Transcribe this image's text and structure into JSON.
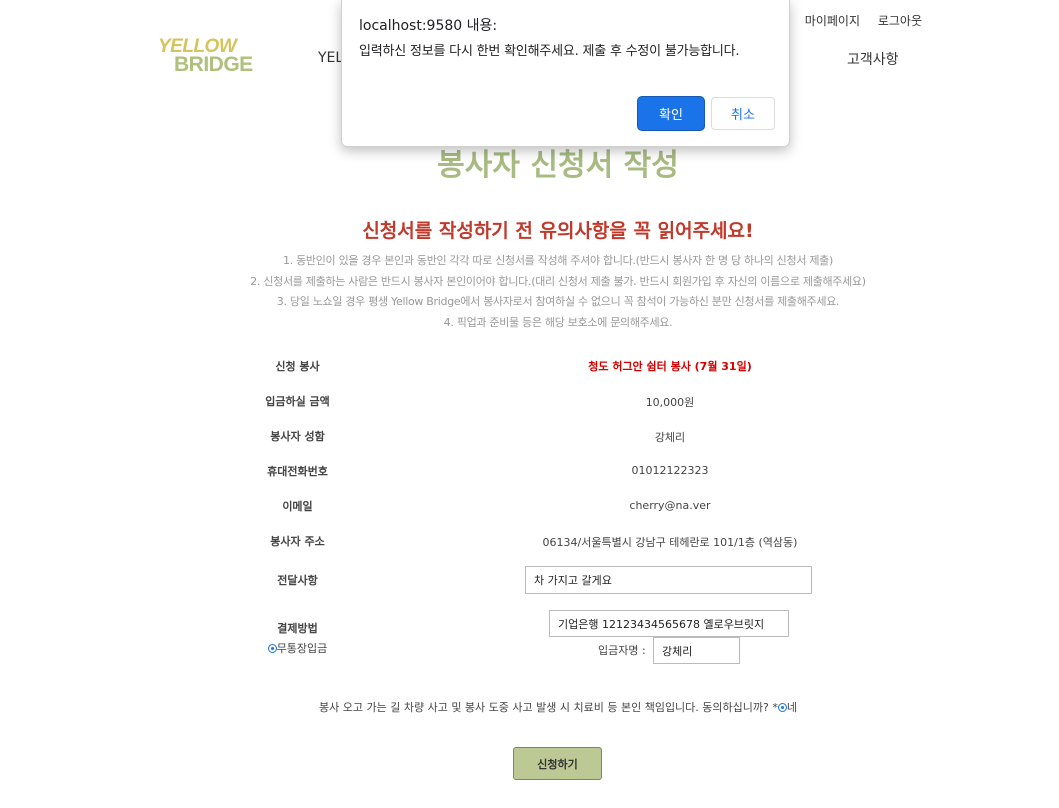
{
  "header": {
    "logo_line1": "YELLOW",
    "logo_line2": "BRIDGE",
    "mypage": "마이페이지",
    "logout": "로그아웃",
    "menu_left_partial": "YELL",
    "menu_support": "고객사항"
  },
  "page": {
    "title": "봉사자 신청서 작성",
    "notice_title": "신청서를 작성하기 전 유의사항을 꼭 읽어주세요!",
    "notices": [
      "1. 동반인이 있을 경우 본인과 동반인 각각 따로 신청서를 작성해 주셔야 합니다.(반드시 봉사자 한 명 당 하나의 신청서 제출)",
      "2. 신청서를 제출하는 사람은 반드시 봉사자 본인이어야 합니다.(대리 신청서 제출 불가. 반드시 회원가입 후 자신의 이름으로 제출해주세요)",
      "3. 당일 노쇼일 경우 평생 Yellow Bridge에서 봉사자로서 참여하실 수 없으니 꼭 참석이 가능하신 분만 신청서를 제출해주세요.",
      "4. 픽업과 준비물 등은 해당 보호소에 문의해주세요."
    ]
  },
  "form": {
    "volunteer_label": "신청 봉사",
    "volunteer_value": "청도 허그안 쉼터 봉사 (7월 31일)",
    "amount_label": "입금하실 금액",
    "amount_value": "10,000원",
    "name_label": "봉사자 성함",
    "name_value": "강체리",
    "phone_label": "휴대전화번호",
    "phone_value": "01012122323",
    "email_label": "이메일",
    "email_value": "cherry@na.ver",
    "address_label": "봉사자 주소",
    "address_value": "06134/서울특별시 강남구 테헤란로 101/1층 (역삼동)",
    "message_label": "전달사항",
    "message_value": "차 가지고 갈게요",
    "payment_label": "결제방법",
    "payment_option": "무통장입금",
    "bank_account": "기업은행 12123434565678 옐로우브릿지",
    "depositor_label": "입금자명 :",
    "depositor_value": "강체리",
    "agreement_text": "봉사 오고 가는 길 차량 사고 및 봉사 도중 사고 발생 시 치료비 등 본인 책임입니다. 동의하십니까? *",
    "agreement_option": "네",
    "submit_label": "신청하기"
  },
  "dialog": {
    "title": "localhost:9580 내용:",
    "message": "입력하신 정보를 다시 한번 확인해주세요. 제출 후 수정이 불가능합니다.",
    "ok_label": "확인",
    "cancel_label": "취소",
    "ok_color": "#1a73e8"
  }
}
